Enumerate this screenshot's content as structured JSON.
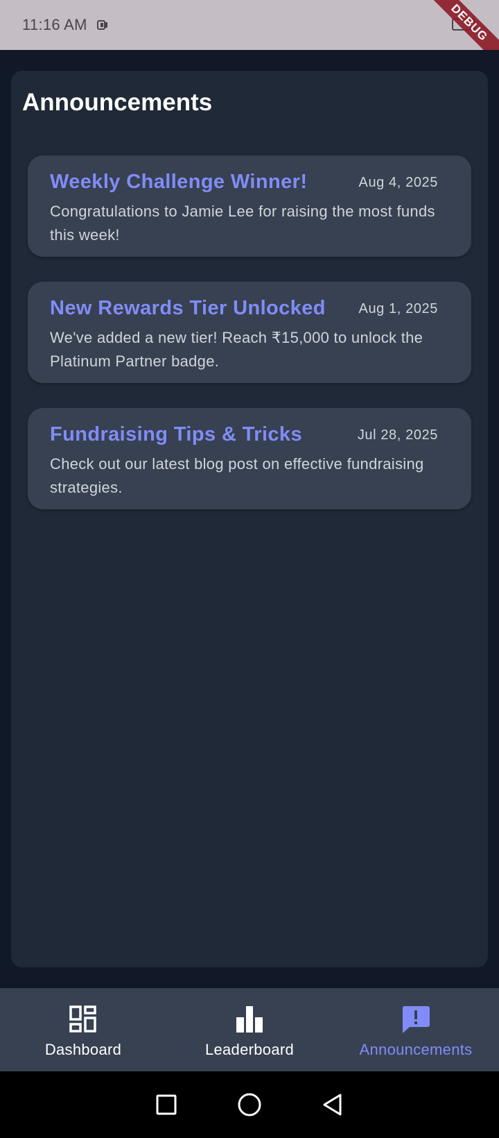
{
  "status_bar": {
    "time": "11:16 AM",
    "app_icon": "status-app-icon",
    "battery_icon": "battery-icon",
    "debug_banner": "DEBUG"
  },
  "page": {
    "title": "Announcements"
  },
  "announcements": [
    {
      "title": "Weekly Challenge Winner!",
      "date": "Aug 4, 2025",
      "body": "Congratulations to Jamie Lee for raising the most funds this week!"
    },
    {
      "title": "New Rewards Tier Unlocked",
      "date": "Aug 1, 2025",
      "body": "We've added a new tier! Reach ₹15,000 to unlock the Platinum Partner badge."
    },
    {
      "title": "Fundraising Tips & Tricks",
      "date": "Jul 28, 2025",
      "body": "Check out our latest blog post on effective fundraising strategies."
    }
  ],
  "bottom_nav": {
    "items": [
      {
        "label": "Dashboard",
        "icon": "dashboard-icon",
        "active": false
      },
      {
        "label": "Leaderboard",
        "icon": "leaderboard-icon",
        "active": false
      },
      {
        "label": "Announcements",
        "icon": "announcement-icon",
        "active": true
      }
    ]
  },
  "colors": {
    "accent": "#818cf8",
    "background": "#111827",
    "panel": "#1f2937",
    "card": "#374151",
    "text_primary": "#ffffff",
    "text_secondary": "#d1d5db",
    "status_bar": "#c4bdc3",
    "debug_banner": "#8e1f2b"
  },
  "system_nav": {
    "buttons": [
      "recents-icon",
      "home-icon",
      "back-icon"
    ]
  }
}
